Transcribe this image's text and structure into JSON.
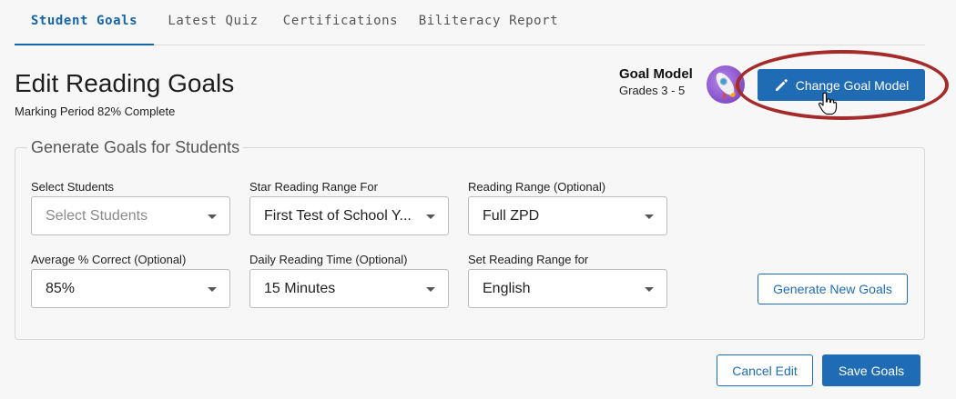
{
  "tabs": [
    {
      "label": "Student Goals",
      "active": true
    },
    {
      "label": "Latest Quiz",
      "active": false
    },
    {
      "label": "Certifications",
      "active": false
    },
    {
      "label": "Biliteracy Report",
      "active": false
    }
  ],
  "header": {
    "title": "Edit Reading Goals",
    "subtitle": "Marking Period 82% Complete",
    "marking_period_complete_percent": 82
  },
  "goal_model": {
    "label": "Goal Model",
    "grades": "Grades 3 - 5",
    "change_button": "Change Goal Model",
    "icon": "rocket-icon"
  },
  "generate_panel": {
    "legend": "Generate Goals for Students",
    "fields": [
      {
        "label": "Select Students",
        "value": "Select Students",
        "placeholder": true
      },
      {
        "label": "Star Reading Range For",
        "value": "First Test of School Y..."
      },
      {
        "label": "Reading Range (Optional)",
        "value": "Full ZPD"
      },
      {
        "label": "Average % Correct (Optional)",
        "value": "85%"
      },
      {
        "label": "Daily Reading Time (Optional)",
        "value": "15 Minutes"
      },
      {
        "label": "Set Reading Range for",
        "value": "English"
      }
    ],
    "generate_button": "Generate New Goals"
  },
  "footer": {
    "cancel_button": "Cancel Edit",
    "save_button": "Save Goals"
  },
  "colors": {
    "accent": "#1f6cb5",
    "highlight": "#a52a2a",
    "background": "#f7f7f8"
  }
}
